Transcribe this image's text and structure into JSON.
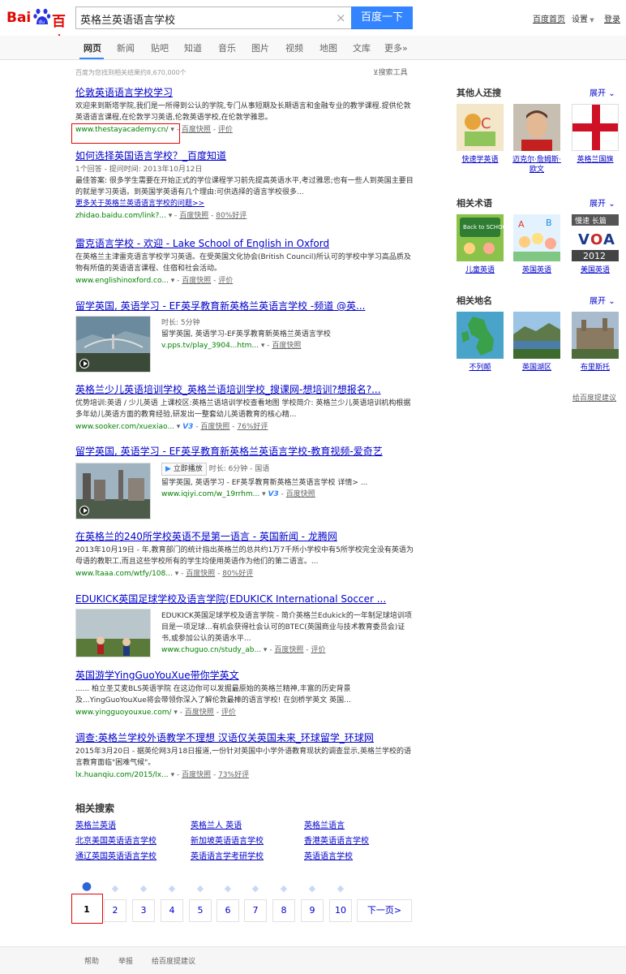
{
  "header": {
    "logo_text_left": "Bai",
    "logo_text_right": "百度",
    "logo_paw": "du",
    "query": "英格兰英语语言学校",
    "search_button": "百度一下",
    "links": {
      "home": "百度首页",
      "settings": "设置",
      "login": "登录"
    }
  },
  "nav": {
    "tabs": [
      "网页",
      "新闻",
      "贴吧",
      "知道",
      "音乐",
      "图片",
      "视频",
      "地图",
      "文库",
      "更多»"
    ]
  },
  "stats": "百度为您找到相关结果约8,670,000个",
  "tools": "搜索工具",
  "results": [
    {
      "title": "伦敦英语语言学校学习",
      "abstract": "欢迎来到斯塔学院,我们是一所得到公认的学院,专门从事短期及长期语言和金融专业的教学课程.提供伦敦英语语言课程,在伦敦学习英语,伦敦英语学校,在伦敦学雅思。",
      "url": "www.thestayacademy.cn/",
      "snap": "百度快照",
      "eval": "评价"
    },
    {
      "title": "如何选择英国语言学校？_百度知道",
      "meta": "1个回答 - 提问时间: 2013年10月12日",
      "abstract": "最佳答案: 很多学生需要在开始正式的学位课程学习前先提高英语水平,考过雅思;也有一些人到英国主要目的就是学习英语。到英国学英语有几个理由:可供选择的语言学校很多...",
      "more": "更多关于英格兰英语语言学校的问题>>",
      "url": "zhidao.baidu.com/link?...",
      "snap": "百度快照",
      "eval": "80%好评"
    },
    {
      "title": "雷克语言学校 - 欢迎 - Lake School of English in Oxford",
      "abstract": "在英格兰主津雷克语言学校学习英语。在受英国文化协会(British Council)所认可的学校中学习高品质及物有所值的英语语言课程、住宿和社会活动。",
      "url": "www.englishinoxford.co...",
      "snap": "百度快照",
      "eval": "评价"
    },
    {
      "title": "留学英国, 英语学习 - EF英孚教育新英格兰英语言学校 -频道 @英...",
      "duration": "时长: 5分钟",
      "desc": "留学英国, 英语学习-EF英孚教育新英格兰英语言学校",
      "url": "v.pps.tv/play_3904...htm...",
      "snap": "百度快照"
    },
    {
      "title": "英格兰少儿英语培训学校_英格兰语培训学校_搜课网-想培训?想报名?...",
      "abstract": "优势培训:英语 / 少儿英语 上课校区:英格兰语培训学校查看地图 学校简介: 英格兰少儿英语培训机构根据多年幼儿英语方面的教育经验,研发出一整套幼儿英语教育的核心精...",
      "url": "www.sooker.com/xuexiao...",
      "v": "V3",
      "snap": "百度快照",
      "eval": "76%好评"
    },
    {
      "title": "留学英国, 英语学习 - EF英孚教育新英格兰英语言学校-教育视频-爱奇艺",
      "play": "立即播放",
      "duration": "时长: 6分钟 - 国语",
      "desc": "留学英国, 英语学习 - EF英孚教育新英格兰英语言学校 详情> ...",
      "url": "www.iqiyi.com/w_19rrhm...",
      "v": "V3",
      "snap": "百度快照"
    },
    {
      "title": "在英格兰的240所学校英语不是第一语言 - 英国新闻 - 龙腾网",
      "abstract": "2013年10月19日 - 年,教育部门的统计指出英格兰的总共约1万7千所小学校中有5所学校完全没有英语为母语的教职工,而且这些学校所有的学生均使用英语作为他们的第二语言。...",
      "url": "www.ltaaa.com/wtfy/108...",
      "snap": "百度快照",
      "eval": "80%好评"
    },
    {
      "title": "EDUKICK英国足球学校及语言学院(EDUKICK International Soccer ...",
      "desc": "EDUKICK英国足球学校及语言学院 - 简介英格兰Edukick的一年制足球培训项目是一项足球...有机会获得社会认可的BTEC(英国商业与技术教育委员会)证书,或参加公认的英语水平...",
      "url": "www.chuguo.cn/study_ab...",
      "snap": "百度快照",
      "eval": "评价"
    },
    {
      "title": "英国游学YingGuoYouXue带你学英文",
      "abstract": "...... 柏立圣艾麦BLS英语学院 在这边你可以发掘最原始的英格兰精神,丰富的历史背景及...YingGuoYouXue将会带领你深入了解伦敦最棒的语言学校! 在剑桥学英文 英国...",
      "url": "www.yingguoyouxue.com/",
      "snap": "百度快照",
      "eval": "评价"
    },
    {
      "title": "调查:英格兰学校外语教学不理想 汉语仅关英国未来_环球留学_环球网",
      "abstract": "2015年3月20日 - 据英伦网3月18日报道,一份针对英国中小学外语教育现状的调查显示,英格兰学校的语言教育面临\"困难气候\"。",
      "url": "lx.huanqiu.com/2015/lx...",
      "snap": "百度快照",
      "eval": "73%好评"
    }
  ],
  "sidebar": {
    "others": {
      "title": "其他人还搜",
      "expand": "展开",
      "items": [
        "快速学英语",
        "迈克尔·詹姆斯·欧文",
        "英格兰国旗"
      ]
    },
    "terms": {
      "title": "相关术语",
      "expand": "展开",
      "items": [
        "儿童英语",
        "英国英语",
        "美国英语"
      ],
      "voa_text": "慢速 长篇",
      "voa_year": "2012",
      "school_text": "Back to SCHOOL"
    },
    "places": {
      "title": "相关地名",
      "expand": "展开",
      "items": [
        "不列颠",
        "英国湖区",
        "布里斯托"
      ]
    },
    "feedback": "给百度提建议"
  },
  "related": {
    "title": "相关搜索",
    "items": [
      "英格兰英语",
      "英格兰人 英语",
      "英格兰语言",
      "北京美国英语语言学校",
      "新加坡英语语言学校",
      "香港英语语言学校",
      "通辽英国英语语言学校",
      "英语语言学考研学校",
      "英语语言学校"
    ]
  },
  "pagination": {
    "pages": [
      "1",
      "2",
      "3",
      "4",
      "5",
      "6",
      "7",
      "8",
      "9",
      "10"
    ],
    "next": "下一页>"
  },
  "footer": {
    "links": [
      "帮助",
      "举报",
      "给百度提建议"
    ]
  }
}
